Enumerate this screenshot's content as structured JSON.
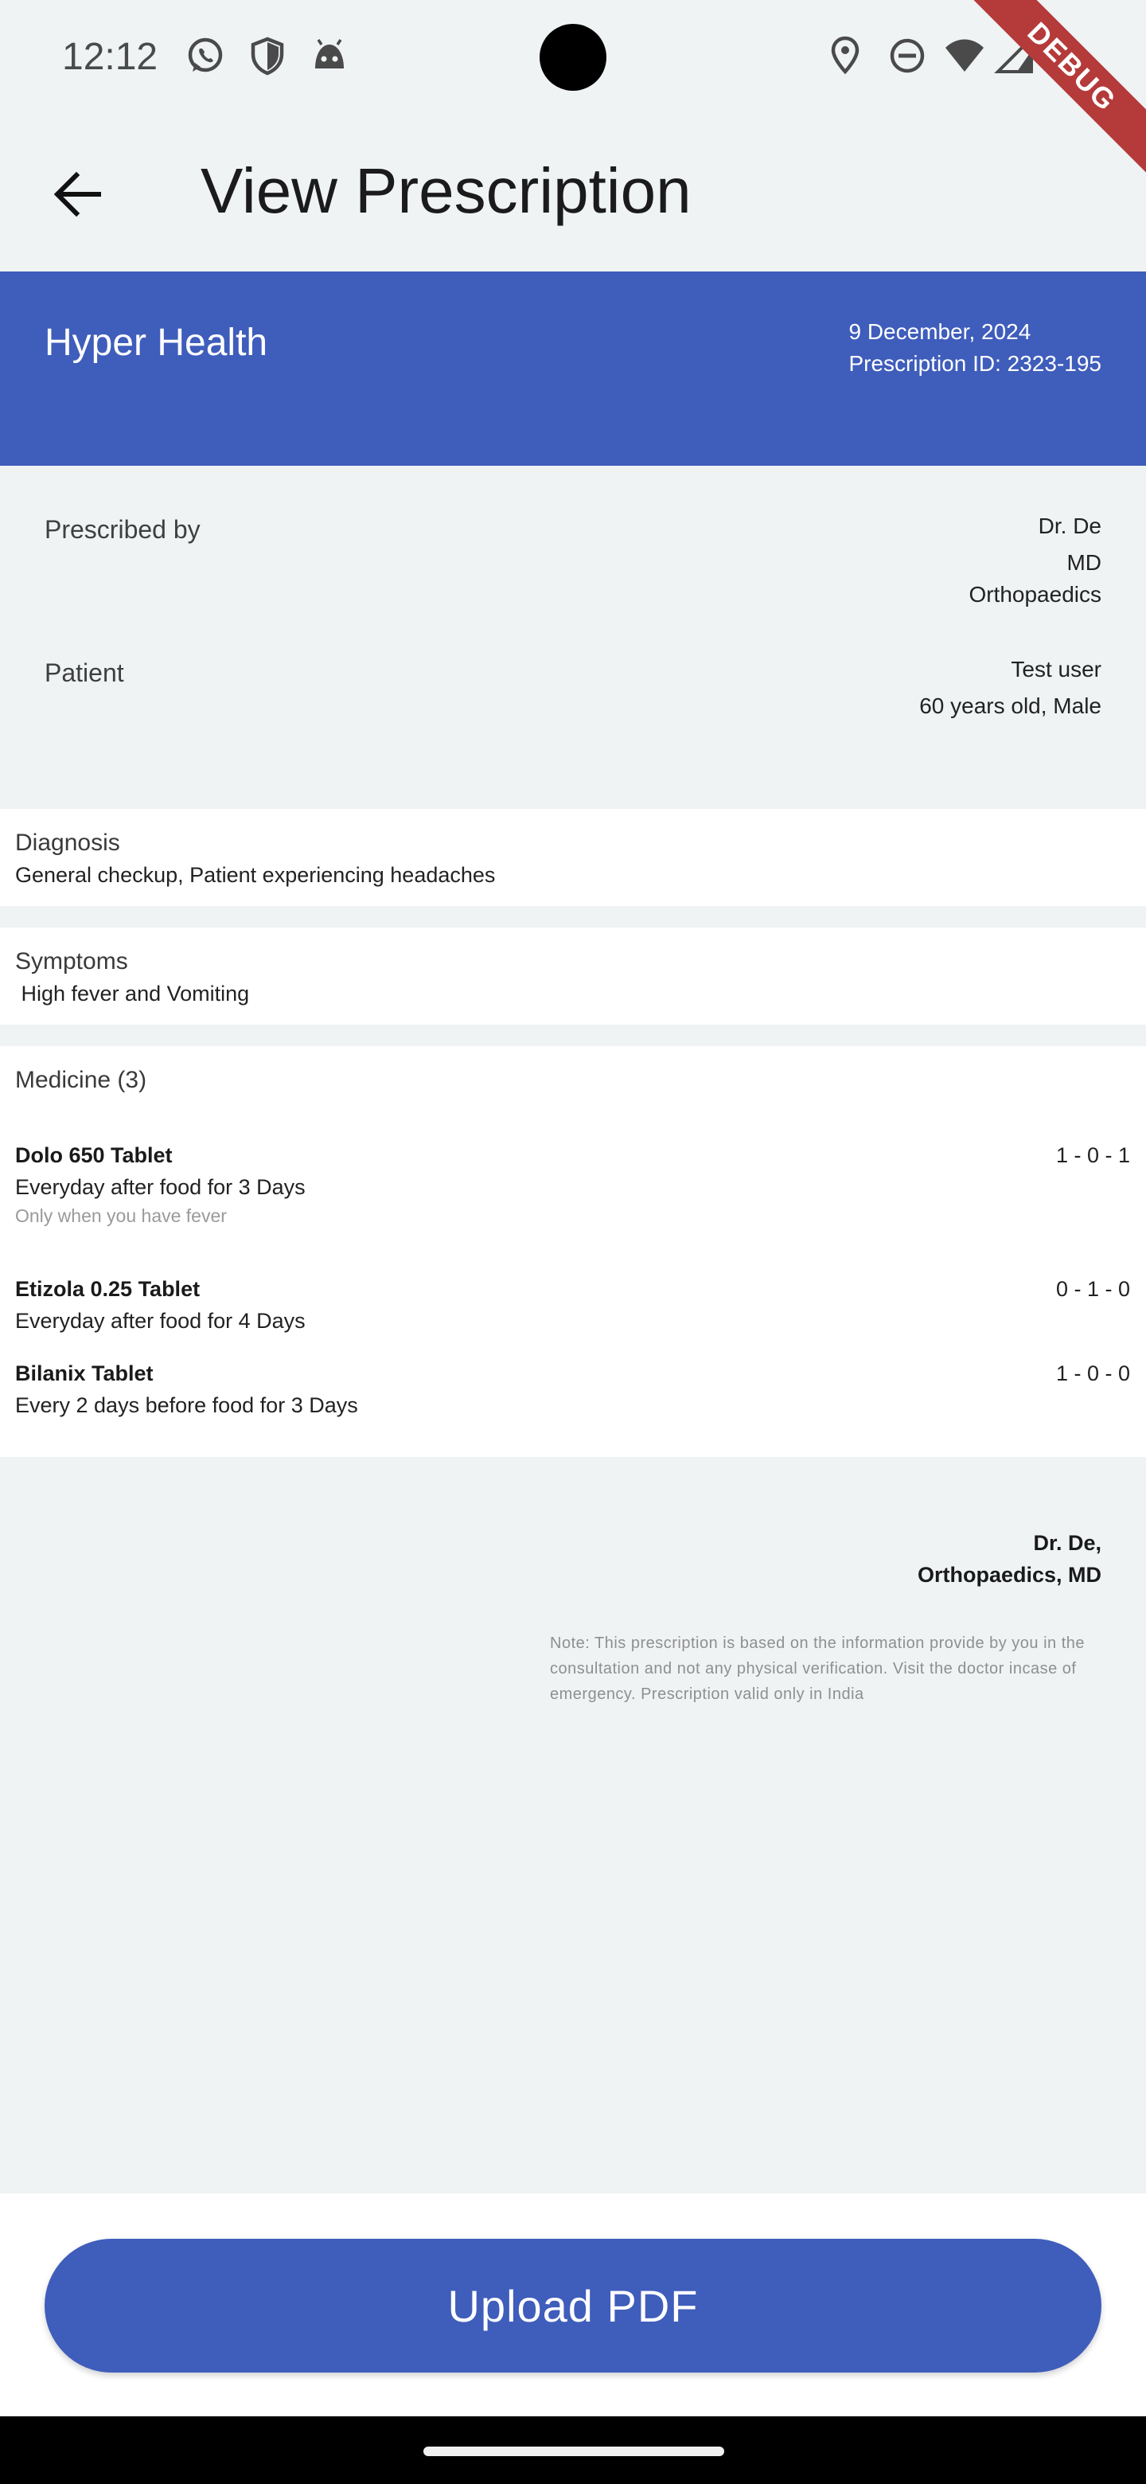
{
  "status_bar": {
    "time": "12:12",
    "left_icons": [
      "whatsapp-icon",
      "shield-icon",
      "android-face-icon"
    ],
    "right_icons": [
      "location-icon",
      "do-not-disturb-icon",
      "wifi-icon",
      "cellular-icon",
      "battery-icon"
    ],
    "debug_label": "DEBUG"
  },
  "app_bar": {
    "back_icon": "arrow-back-icon",
    "title": "View Prescription"
  },
  "header": {
    "clinic_name": "Hyper Health",
    "date": "9 December, 2024",
    "prescription_id": "Prescription ID: 2323-195",
    "color": "#3F5DBB"
  },
  "prescriber": {
    "label": "Prescribed by",
    "name": "Dr. De",
    "degree": "MD",
    "specialty": "Orthopaedics"
  },
  "patient": {
    "label": "Patient",
    "name": "Test user",
    "details": "60 years old, Male"
  },
  "diagnosis": {
    "label": "Diagnosis",
    "value": "General checkup, Patient experiencing headaches"
  },
  "symptoms": {
    "label": "Symptoms",
    "value": " High fever and Vomiting"
  },
  "medicine": {
    "label": "Medicine (3)",
    "items": [
      {
        "name": "Dolo 650 Tablet",
        "schedule": "Everyday after food for 3 Days",
        "note": "Only when you have fever",
        "dosage": "1 - 0 - 1"
      },
      {
        "name": "Etizola 0.25 Tablet",
        "schedule": "Everyday after food for 4 Days",
        "note": "",
        "dosage": "0 - 1 - 0"
      },
      {
        "name": "Bilanix Tablet",
        "schedule": "Every 2 days before food for 3 Days",
        "note": "",
        "dosage": "1 - 0 - 0"
      }
    ]
  },
  "signature": {
    "line1": "Dr. De,",
    "line2": "Orthopaedics, MD"
  },
  "footer_note": "Note: This prescription is based on the information provide by you in the consultation and not any physical verification. Visit the doctor incase of emergency. Prescription valid only in India",
  "actions": {
    "upload_label": "Upload PDF"
  }
}
